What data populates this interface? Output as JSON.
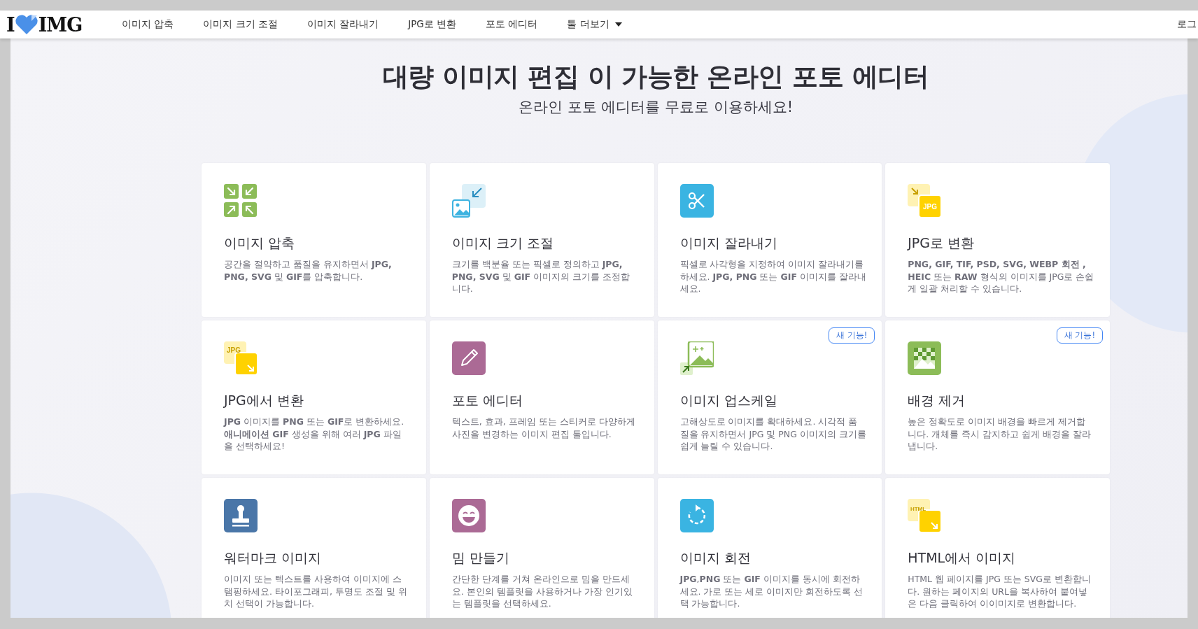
{
  "nav": {
    "logo": {
      "left": "I",
      "right": "IMG"
    },
    "items": [
      {
        "label": "이미지 압축",
        "dropdown": false
      },
      {
        "label": "이미지 크기 조절",
        "dropdown": false
      },
      {
        "label": "이미지 잘라내기",
        "dropdown": false
      },
      {
        "label": "JPG로 변환",
        "dropdown": false
      },
      {
        "label": "포토 에디터",
        "dropdown": false
      },
      {
        "label": "툴 더보기",
        "dropdown": true
      }
    ],
    "login": "로그"
  },
  "hero": {
    "title": "대량 이미지 편집 이 가능한 온라인 포토 에디터",
    "subtitle": "온라인 포토 에디터를 무료로 이용하세요!"
  },
  "tools": [
    {
      "kind": "compress",
      "title": "이미지 압축",
      "description": "공간을 절약하고 품질을 유지하면서 **JPG, PNG, SVG** 및 **GIF**를 압축합니다."
    },
    {
      "kind": "resize",
      "title": "이미지 크기 조절",
      "description": "크기를 백분율 또는 픽셀로 정의하고 **JPG, PNG, SVG** 및 **GIF** 이미지의 크기를 조정합니다."
    },
    {
      "kind": "crop",
      "title": "이미지 잘라내기",
      "description": "픽셀로 사각형을 지정하여 이미지 잘라내기를 하세요. **JPG, PNG** 또는 **GIF** 이미지를 잘라내세요."
    },
    {
      "kind": "to-jpg",
      "title": "JPG로 변환",
      "icon_text": "JPG",
      "description": "**PNG, GIF, TIF, PSD, SVG, WEBP 회전 , HEIC** 또는 **RAW** 형식의 이미지를 JPG로 손쉽게 일괄 처리할 수 있습니다."
    },
    {
      "kind": "from-jpg",
      "title": "JPG에서 변환",
      "icon_text": "JPG",
      "description": "**JPG** 이미지를 **PNG** 또는 **GIF**로 변환하세요. **애니메이션 GIF** 생성을 위해 여러 **JPG** 파일을 선택하세요!"
    },
    {
      "kind": "edit",
      "title": "포토 에디터",
      "description": "텍스트, 효과, 프레임 또는 스티커로 다양하게 사진을 변경하는 이미지 편집 툴입니다."
    },
    {
      "kind": "upscale",
      "title": "이미지 업스케일",
      "badge": "새 기능!",
      "description": "고해상도로 이미지를 확대하세요. 시각적 품질을 유지하면서 JPG 및 PNG 이미지의 크기를 쉽게 늘릴 수 있습니다."
    },
    {
      "kind": "remove-bg",
      "title": "배경 제거",
      "badge": "새 기능!",
      "description": "높은 정확도로 이미지 배경을 빠르게 제거합니다. 개체를 즉시 감지하고 쉽게 배경을 잘라냅니다."
    },
    {
      "kind": "watermark",
      "title": "워터마크 이미지",
      "description": "이미지 또는 텍스트를 사용하여 이미지에 스탬핑하세요. 타이포그래피, 투명도 조절 및 위치 선택이 가능합니다."
    },
    {
      "kind": "meme",
      "title": "밈 만들기",
      "description": "간단한 단계를 거쳐 온라인으로 밈을 만드세요. 본인의 템플릿을 사용하거나 가장 인기있는 템플릿을 선택하세요."
    },
    {
      "kind": "rotate",
      "title": "이미지 회전",
      "description": "**JPG**,**PNG** 또는 **GIF** 이미지를 동시에 회전하세요. 가로 또는 세로 이미지만 회전하도록 선택 가능합니다."
    },
    {
      "kind": "html",
      "title": "HTML에서 이미지",
      "icon_text": "HTML",
      "description": "HTML 웹 페이지를 JPG 또는 SVG로 변환합니다. 원하는 페이지의 URL을 복사하여 붙여넣은 다음 클릭하여 이이미지로 변환합니다."
    }
  ]
}
